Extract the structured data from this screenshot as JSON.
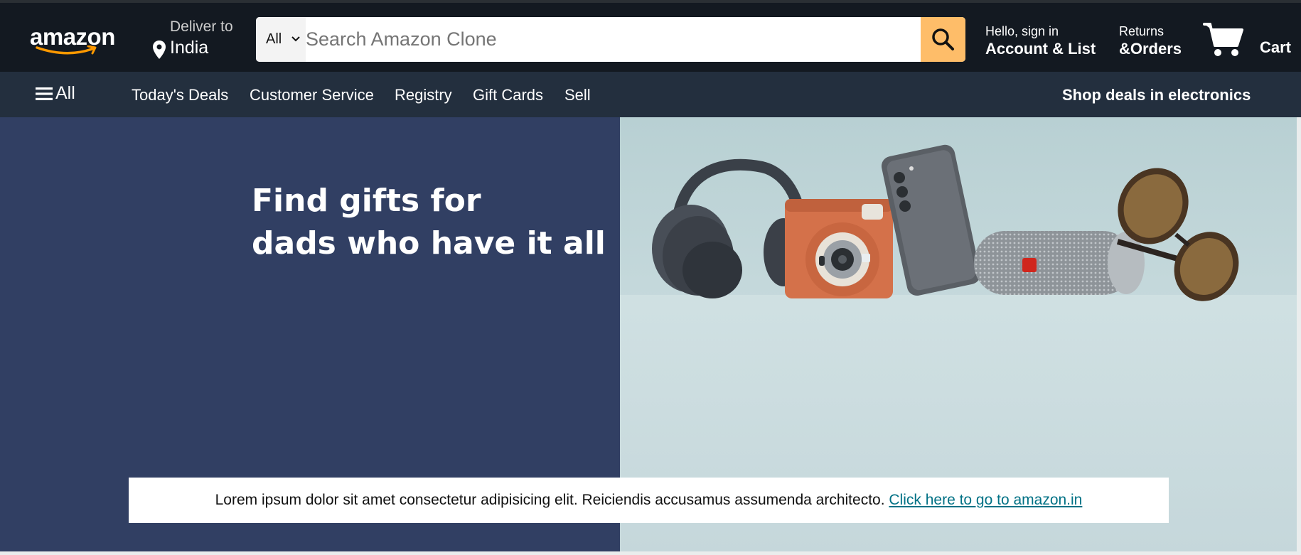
{
  "header": {
    "logo_text": "amazon",
    "deliver": {
      "line1": "Deliver to",
      "line2": "India"
    },
    "search": {
      "category": "All",
      "placeholder": "Search Amazon Clone",
      "value": ""
    },
    "account": {
      "line1": "Hello, sign in",
      "line2": "Account & List"
    },
    "returns": {
      "line1": "Returns",
      "line2": "&Orders"
    },
    "cart": {
      "label": "Cart"
    }
  },
  "subnav": {
    "all_label": "All",
    "links": [
      "Today's Deals",
      "Customer Service",
      "Registry",
      "Gift Cards",
      "Sell"
    ],
    "promo": "Shop deals in electronics"
  },
  "hero": {
    "headline_line1": "Find gifts for",
    "headline_line2": "dads who have it all"
  },
  "banner": {
    "text": "Lorem ipsum dolor sit amet consectetur adipisicing elit. Reiciendis accusamus assumenda architecto.",
    "link_text": "Click here to go to amazon.in"
  },
  "colors": {
    "topbar": "#131921",
    "subnav": "#232f3e",
    "search_button": "#febd69",
    "hero_left": "#313f63",
    "link": "#007185"
  }
}
